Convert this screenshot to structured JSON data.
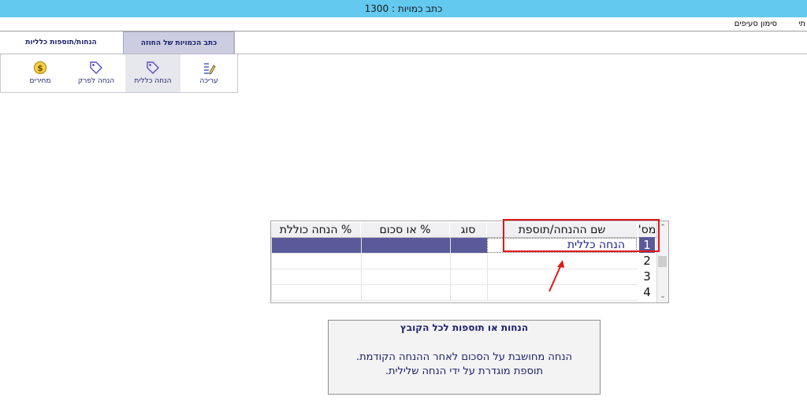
{
  "window": {
    "title": "כתב כמויות : 1300"
  },
  "menu": {
    "item": "סימון סעיפים",
    "item2": "תי"
  },
  "tabs": [
    {
      "label": "כתב הכמויות של החוזה",
      "active": true
    },
    {
      "label": "הנחות/תוספות כלליות",
      "active": false
    }
  ],
  "toolbar": {
    "buttons": [
      {
        "label": "עריכה",
        "icon": "edit-list-icon"
      },
      {
        "label": "הנחה כללית",
        "icon": "tag-icon",
        "active": true
      },
      {
        "label": "הנחה לפרק",
        "icon": "tag-icon"
      },
      {
        "label": "מחירים",
        "icon": "dollar-coin-icon"
      }
    ]
  },
  "grid": {
    "columns": [
      "מס'",
      "שם ההנחה/תוספת",
      "סוג",
      "% או סכום",
      "% הנחה כוללת"
    ],
    "rows": [
      {
        "num": "1",
        "name": "הנחה כללית",
        "type": "",
        "amount": "",
        "total": "",
        "selected": true
      },
      {
        "num": "2",
        "name": "",
        "type": "",
        "amount": "",
        "total": "",
        "selected": false
      },
      {
        "num": "3",
        "name": "",
        "type": "",
        "amount": "",
        "total": "",
        "selected": false
      },
      {
        "num": "4",
        "name": "",
        "type": "",
        "amount": "",
        "total": "",
        "selected": false
      }
    ]
  },
  "info": {
    "title": "הנחות או תוספות לכל הקובץ",
    "line1": "הנחה מחושבת על הסכום לאחר ההנחה הקודמת.",
    "line2": "תוספת מוגדרת  על ידי הנחה שלילית."
  },
  "colors": {
    "titlebar": "#63c9ef",
    "selection": "#5a5a9a",
    "accent_text": "#1a1f6b",
    "highlight": "#e01818"
  }
}
